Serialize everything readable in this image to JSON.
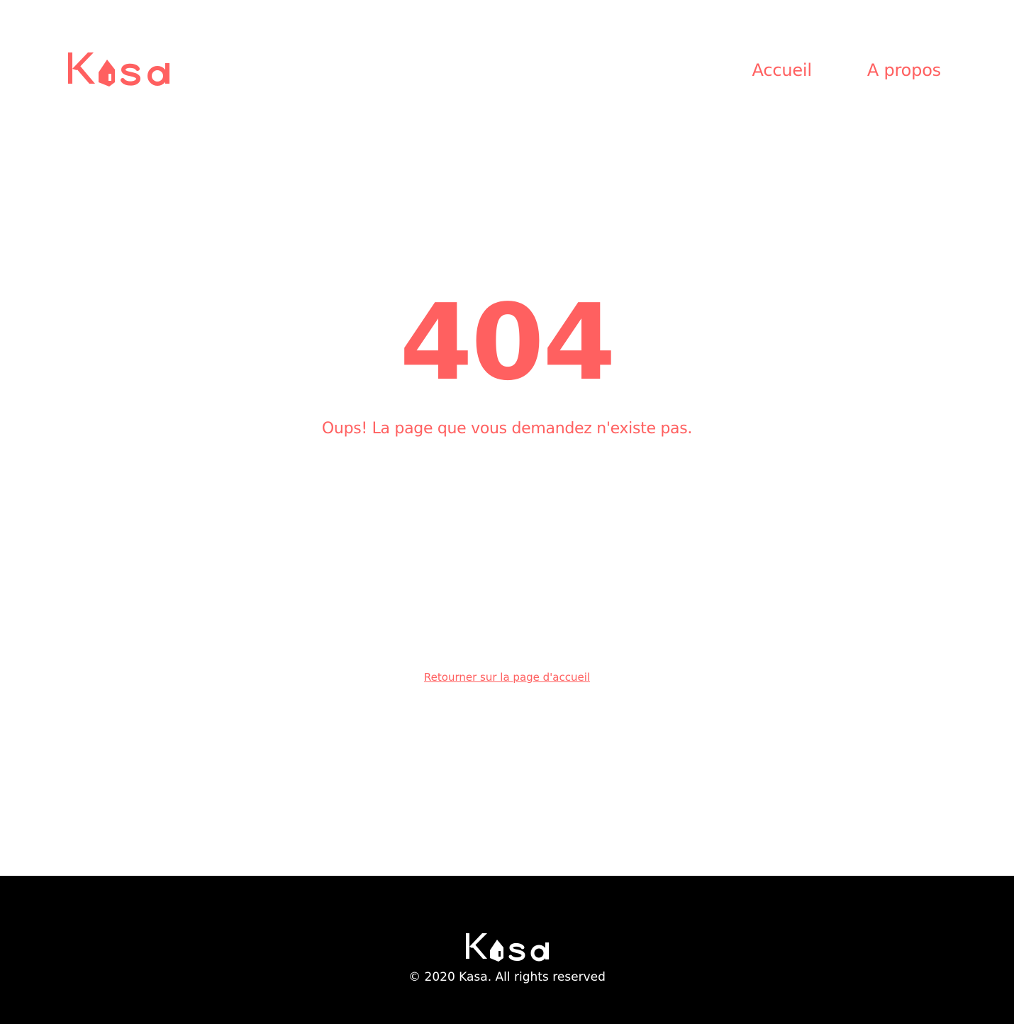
{
  "colors": {
    "accent": "#FF6060",
    "footer_background": "#000000",
    "footer_text": "#FFFFFF",
    "page_background": "#FFFFFF"
  },
  "header": {
    "logo_text": "Kasa",
    "nav": [
      {
        "label": "Accueil"
      },
      {
        "label": "A propos"
      }
    ]
  },
  "main": {
    "error_code": "404",
    "error_message": "Oups! La page que vous demandez n'existe pas.",
    "home_link_label": "Retourner sur la page d'accueil"
  },
  "footer": {
    "logo_text": "Kasa",
    "copyright": "© 2020 Kasa. All rights reserved"
  },
  "icons": {
    "logo_house": "house-icon"
  }
}
